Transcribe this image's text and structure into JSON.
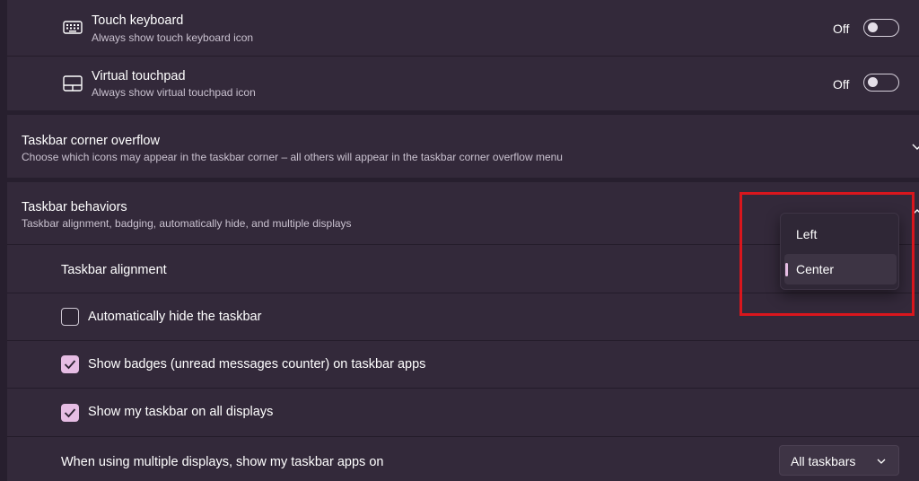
{
  "touch_keyboard": {
    "title": "Touch keyboard",
    "description": "Always show touch keyboard icon",
    "icon": "keyboard-icon",
    "state": "Off"
  },
  "virtual_touchpad": {
    "title": "Virtual touchpad",
    "description": "Always show virtual touchpad icon",
    "icon": "touchpad-icon",
    "state": "Off"
  },
  "corner_overflow": {
    "title": "Taskbar corner overflow",
    "description": "Choose which icons may appear in the taskbar corner – all others will appear in the taskbar corner overflow menu"
  },
  "behaviors": {
    "title": "Taskbar behaviors",
    "description": "Taskbar alignment, badging, automatically hide, and multiple displays",
    "alignment": {
      "label": "Taskbar alignment",
      "options": [
        "Left",
        "Center"
      ],
      "selected": "Center"
    },
    "auto_hide": {
      "label": "Automatically hide the taskbar",
      "checked": false
    },
    "show_badges": {
      "label": "Show badges (unread messages counter) on taskbar apps",
      "checked": true
    },
    "all_displays": {
      "label": "Show my taskbar on all displays",
      "checked": true
    },
    "multi_display": {
      "label": "When using multiple displays, show my taskbar apps on",
      "value": "All taskbars"
    }
  },
  "colors": {
    "background": "#271f2e",
    "card": "#33293a",
    "accent": "#e6bde4",
    "highlight_box": "#d9161d"
  }
}
